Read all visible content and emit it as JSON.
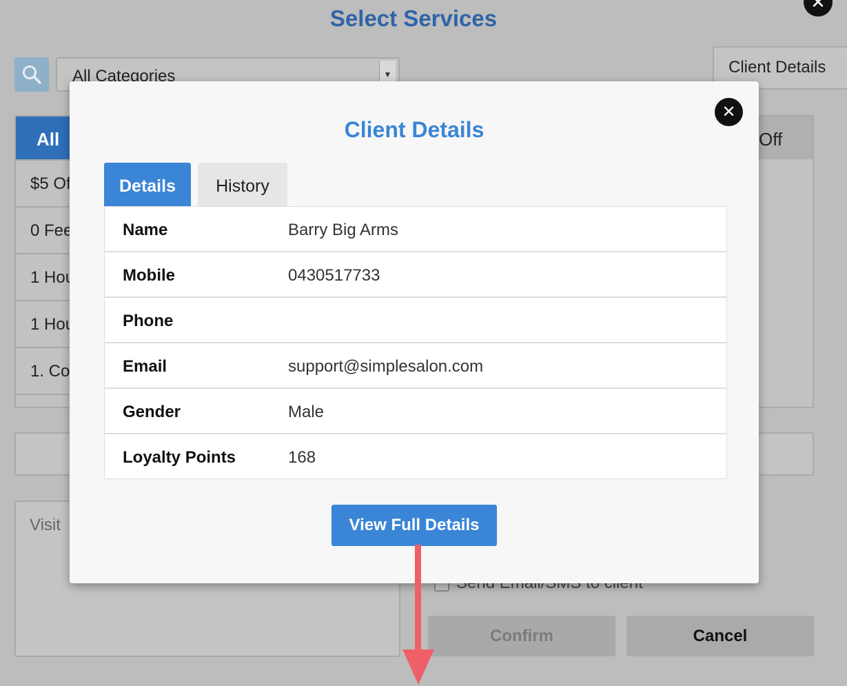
{
  "page": {
    "title": "Select Services",
    "close_glyph": "✕"
  },
  "filters": {
    "search_icon": "search-icon",
    "category_select": "All Categories",
    "client_details_button": "Client Details"
  },
  "service_tabs": {
    "all": "All",
    "partial_right": "l Off"
  },
  "service_list": [
    "$5 Of",
    "0 Fee",
    "1 Hou",
    "1 Hou",
    "1. Co"
  ],
  "visit_notes_placeholder": "Visit",
  "send_checkbox_label": "Send Email/SMS to client",
  "footer": {
    "confirm": "Confirm",
    "cancel": "Cancel"
  },
  "modal": {
    "title": "Client Details",
    "close_glyph": "✕",
    "tabs": [
      {
        "label": "Details",
        "active": true
      },
      {
        "label": "History",
        "active": false
      }
    ],
    "rows": [
      {
        "label": "Name",
        "value": "Barry Big Arms"
      },
      {
        "label": "Mobile",
        "value": "0430517733"
      },
      {
        "label": "Phone",
        "value": ""
      },
      {
        "label": "Email",
        "value": "support@simplesalon.com"
      },
      {
        "label": "Gender",
        "value": "Male"
      },
      {
        "label": "Loyalty Points",
        "value": "168"
      }
    ],
    "view_full_details": "View Full Details"
  },
  "colors": {
    "accent": "#3a85d6",
    "overlay_bg": "#bdbdbd",
    "annotation_arrow": "#ef5f68"
  }
}
